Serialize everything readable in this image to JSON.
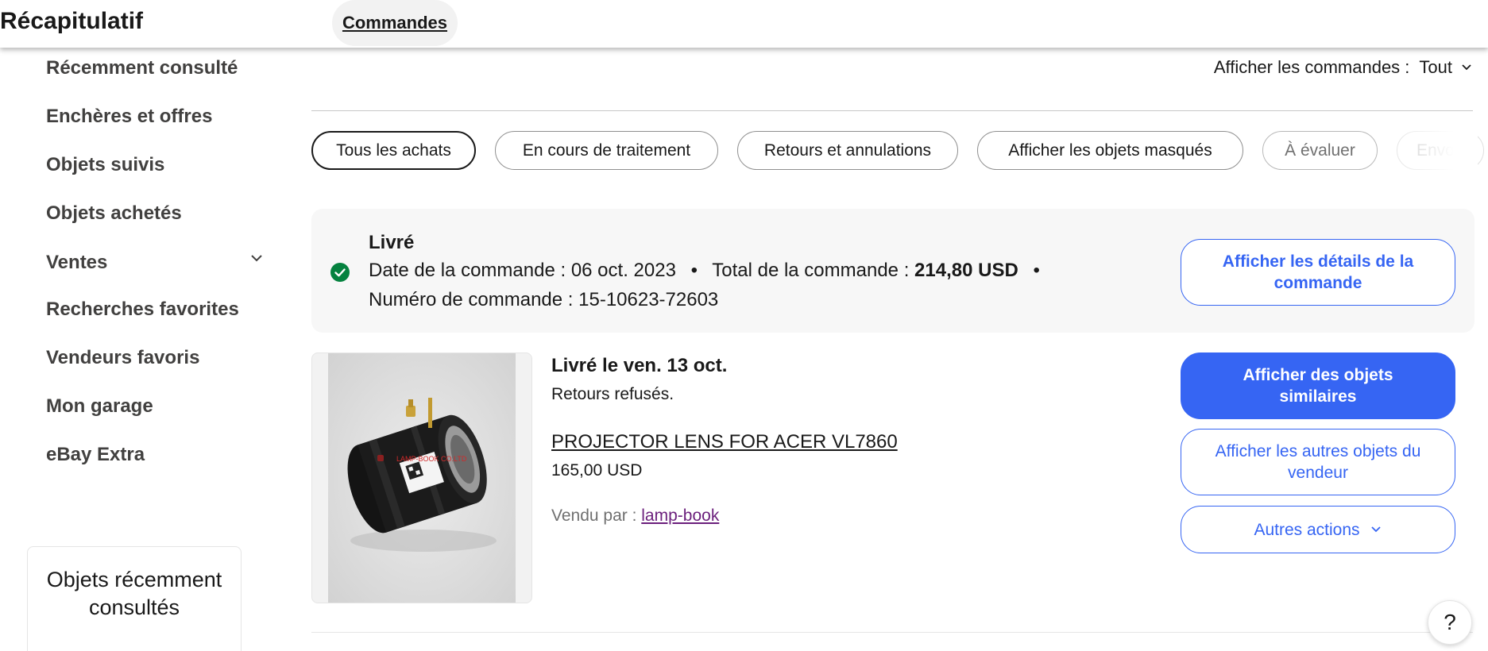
{
  "header": {
    "title": "Récapitulatif",
    "tab_label": "Commandes"
  },
  "sidebar": {
    "items": [
      {
        "label": "Récemment consulté"
      },
      {
        "label": "Enchères et offres"
      },
      {
        "label": "Objets suivis"
      },
      {
        "label": "Objets achetés"
      },
      {
        "label": "Ventes"
      },
      {
        "label": "Recherches favorites"
      },
      {
        "label": "Vendeurs favoris"
      },
      {
        "label": "Mon garage"
      },
      {
        "label": "eBay Extra"
      }
    ],
    "recent_box_title": "Objets récemment consultés"
  },
  "filter": {
    "label": "Afficher les commandes :",
    "value": "Tout"
  },
  "tabs": [
    {
      "label": "Tous les achats"
    },
    {
      "label": "En cours de traitement"
    },
    {
      "label": "Retours et annulations"
    },
    {
      "label": "Afficher les objets masqués"
    },
    {
      "label": "À évaluer"
    },
    {
      "label": "Envoyé"
    }
  ],
  "order": {
    "status": "Livré",
    "date_label": "Date de la commande :",
    "date_value": "06 oct. 2023",
    "total_label": "Total de la commande :",
    "total_value": "214,80 USD",
    "separator": "•",
    "number_label": "Numéro de commande :",
    "number_value": "15-10623-72603",
    "details_button": "Afficher les détails de la commande"
  },
  "item": {
    "delivered": "Livré le ven. 13 oct.",
    "returns": "Retours refusés.",
    "title": "PROJECTOR LENS FOR ACER VL7860",
    "price": "165,00 USD",
    "seller_label": "Vendu par :",
    "seller_name": "lamp-book",
    "image_watermark": "LAMP-BOOK CO.LTD",
    "actions": {
      "similar": "Afficher des objets similaires",
      "seller_items": "Afficher les autres objets du vendeur",
      "more": "Autres actions"
    }
  },
  "help": {
    "label": "?"
  },
  "colors": {
    "accent": "#3665f3",
    "success": "#05823f",
    "link_visited": "#6b1f7c",
    "card_bg": "#f7f7f7"
  },
  "icons": {
    "status": "check-circle-icon",
    "chevron": "chevron-down-icon"
  }
}
